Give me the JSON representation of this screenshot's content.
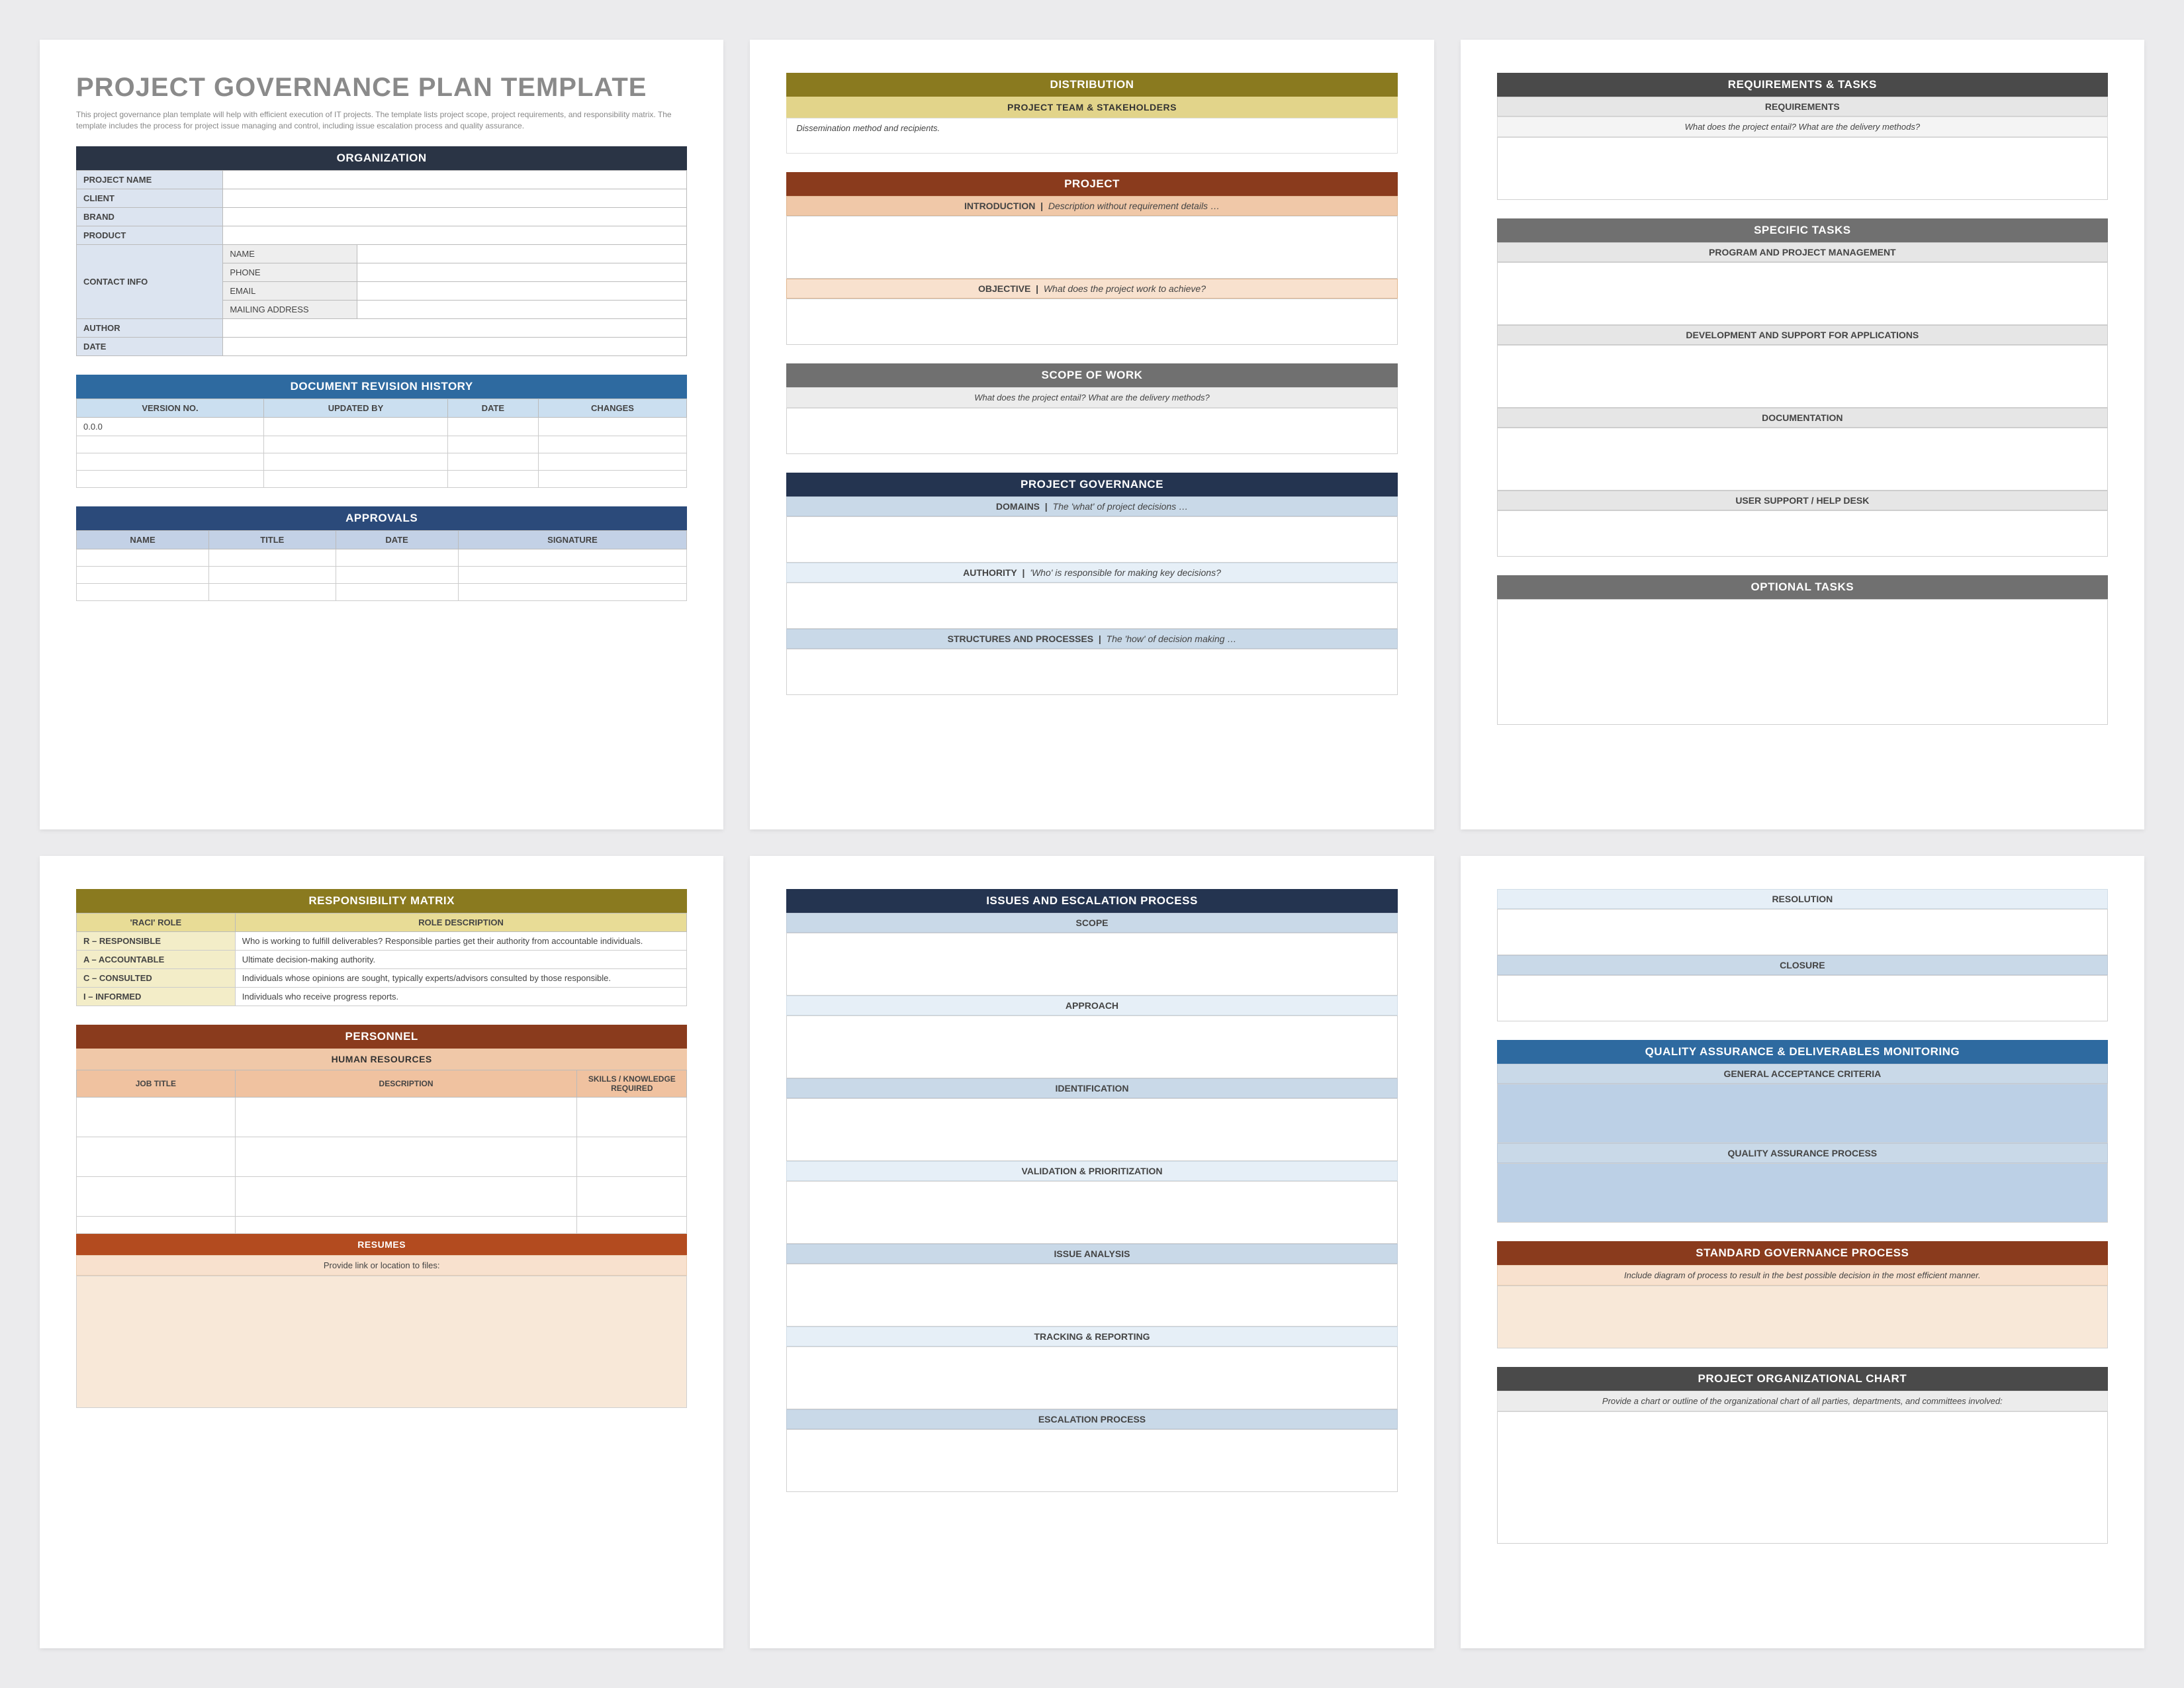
{
  "page1": {
    "title": "PROJECT GOVERNANCE PLAN TEMPLATE",
    "intro": "This project governance plan template will help with efficient execution of IT projects. The template lists project scope, project requirements, and responsibility matrix. The template includes the process for project issue managing and control, including issue escalation process and quality assurance.",
    "orgHeader": "ORGANIZATION",
    "org": {
      "projectName": "PROJECT NAME",
      "client": "CLIENT",
      "brand": "BRAND",
      "product": "PRODUCT",
      "contact": "CONTACT INFO",
      "name": "NAME",
      "phone": "PHONE",
      "email": "EMAIL",
      "mail": "MAILING ADDRESS",
      "author": "AUTHOR",
      "date": "DATE"
    },
    "revHeader": "DOCUMENT REVISION HISTORY",
    "rev": {
      "c1": "VERSION NO.",
      "c2": "UPDATED BY",
      "c3": "DATE",
      "c4": "CHANGES",
      "v1": "0.0.0"
    },
    "apprHeader": "APPROVALS",
    "appr": {
      "c1": "NAME",
      "c2": "TITLE",
      "c3": "DATE",
      "c4": "SIGNATURE"
    }
  },
  "page2": {
    "dist": "DISTRIBUTION",
    "team": "PROJECT TEAM & STAKEHOLDERS",
    "teamDesc": "Dissemination method and recipients.",
    "proj": "PROJECT",
    "intro": "INTRODUCTION",
    "introDesc": "Description without requirement details …",
    "obj": "OBJECTIVE",
    "objDesc": "What does the project work to achieve?",
    "scope": "SCOPE OF WORK",
    "scopeDesc": "What does the project entail? What are the delivery methods?",
    "gov": "PROJECT GOVERNANCE",
    "domains": "DOMAINS",
    "domainsDesc": "The 'what' of project decisions …",
    "auth": "AUTHORITY",
    "authDesc": "'Who' is responsible for making key decisions?",
    "struct": "STRUCTURES AND PROCESSES",
    "structDesc": "The 'how' of decision making …"
  },
  "page3": {
    "req": "REQUIREMENTS & TASKS",
    "reqSub": "REQUIREMENTS",
    "reqDesc": "What does the project entail? What are the delivery methods?",
    "tasks": "SPECIFIC TASKS",
    "t1": "PROGRAM AND PROJECT MANAGEMENT",
    "t2": "DEVELOPMENT AND SUPPORT FOR APPLICATIONS",
    "t3": "DOCUMENTATION",
    "t4": "USER SUPPORT / HELP DESK",
    "opt": "OPTIONAL TASKS"
  },
  "page4": {
    "matrix": "RESPONSIBILITY MATRIX",
    "col1": "'RACI' ROLE",
    "col2": "ROLE DESCRIPTION",
    "rows": [
      {
        "r": "R – RESPONSIBLE",
        "d": "Who is working to fulfill deliverables? Responsible parties get their authority from accountable individuals."
      },
      {
        "r": "A – ACCOUNTABLE",
        "d": "Ultimate decision-making authority."
      },
      {
        "r": "C – CONSULTED",
        "d": "Individuals whose opinions are sought, typically experts/advisors consulted by those responsible."
      },
      {
        "r": "I – INFORMED",
        "d": "Individuals who receive progress reports."
      }
    ],
    "personnel": "PERSONNEL",
    "hr": "HUMAN RESOURCES",
    "pc1": "JOB TITLE",
    "pc2": "DESCRIPTION",
    "pc3": "SKILLS / KNOWLEDGE REQUIRED",
    "resumes": "RESUMES",
    "resumesDesc": "Provide link or location to files:"
  },
  "page5": {
    "header": "ISSUES AND ESCALATION PROCESS",
    "s1": "SCOPE",
    "s2": "APPROACH",
    "s3": "IDENTIFICATION",
    "s4": "VALIDATION & PRIORITIZATION",
    "s5": "ISSUE ANALYSIS",
    "s6": "TRACKING & REPORTING",
    "s7": "ESCALATION PROCESS"
  },
  "page6": {
    "res": "RESOLUTION",
    "clos": "CLOSURE",
    "qa": "QUALITY ASSURANCE & DELIVERABLES MONITORING",
    "gac": "GENERAL ACCEPTANCE CRITERIA",
    "qap": "QUALITY ASSURANCE PROCESS",
    "sgp": "STANDARD GOVERNANCE PROCESS",
    "sgpDesc": "Include diagram of process to result in the best possible decision in the most efficient manner.",
    "orgChart": "PROJECT ORGANIZATIONAL CHART",
    "orgChartDesc": "Provide a chart or outline of the organizational chart of all parties, departments, and committees involved:"
  }
}
